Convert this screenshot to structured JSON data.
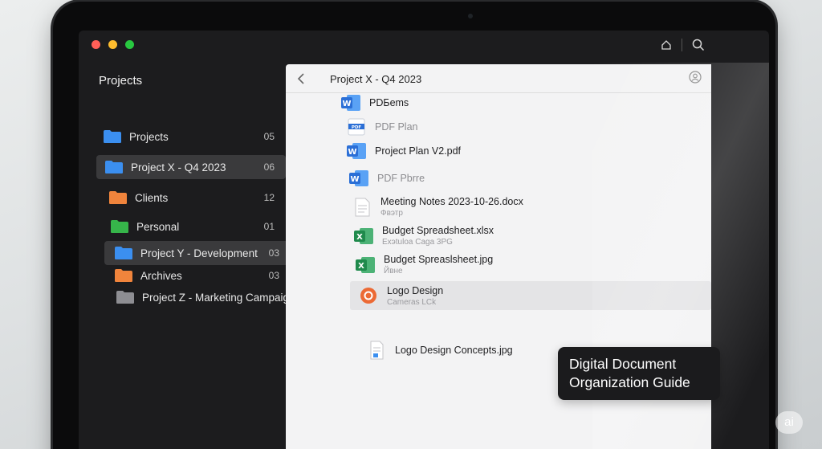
{
  "window": {
    "controls": [
      "close",
      "minimize",
      "zoom"
    ],
    "top_icons": [
      "home-icon",
      "search-icon"
    ]
  },
  "sidebar": {
    "title": "Projects",
    "items": [
      {
        "label": "Projects",
        "count": "05",
        "color": "#3b8ff0",
        "selected": false
      },
      {
        "label": "Project X - Q4 2023",
        "count": "06",
        "color": "#3b8ff0",
        "selected": true
      },
      {
        "label": "Clients",
        "count": "12",
        "color": "#f0843c",
        "selected": false
      },
      {
        "label": "Personal",
        "count": "01",
        "color": "#36b54a",
        "selected": false
      },
      {
        "label": "Project Y - Development",
        "count": "03",
        "color": "#3b8ff0",
        "selected": true
      },
      {
        "label": "Archives",
        "count": "03",
        "color": "#f0843c",
        "selected": false
      },
      {
        "label": "Project Z - Marketing Campaign",
        "count": "",
        "color": "#8e8e93",
        "selected": false
      }
    ]
  },
  "pane": {
    "title": "Project X - Q4 2023",
    "files": [
      {
        "name": "PDБems",
        "sub": "",
        "icon": "word-icon",
        "muted": false
      },
      {
        "name": "PDF Plan",
        "sub": "",
        "icon": "pdf-icon",
        "muted": true
      },
      {
        "name": "Project Plan V2.pdf",
        "sub": "",
        "icon": "word-icon",
        "muted": false
      },
      {
        "name": "PDF Pbrre",
        "sub": "",
        "icon": "word-icon",
        "muted": true
      },
      {
        "name": "Meeting Notes 2023-10-26.docx",
        "sub": "Фвэтр",
        "icon": "document-icon",
        "muted": false
      },
      {
        "name": "Budget Spreadsheet.xlsx",
        "sub": "Exэtuloa Caga 3PG",
        "icon": "excel-icon",
        "muted": false
      },
      {
        "name": "Budget Spreaslsheet.jpg",
        "sub": "Йвнe",
        "icon": "excel-icon",
        "muted": false
      },
      {
        "name": "Logo Design",
        "sub": "Cameras LCk",
        "icon": "logo-design-icon",
        "muted": false
      },
      {
        "name": "Logo Design Concepts.jpg",
        "sub": "",
        "icon": "image-file-icon",
        "muted": false
      }
    ]
  },
  "guide_label": {
    "line1": "Digital Document",
    "line2": "Organization Guide"
  },
  "badge": "ai",
  "colors": {
    "word": "#2b6fd6",
    "excel": "#1f8a4c",
    "pdf_red": "#d8443a",
    "logo_orange": "#ec6a35"
  }
}
